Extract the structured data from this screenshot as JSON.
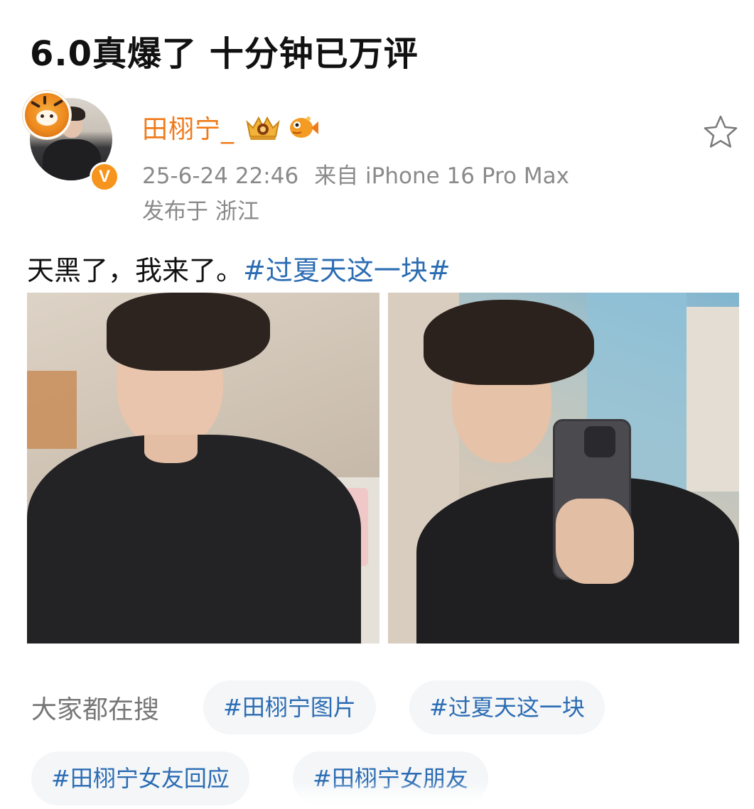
{
  "headline": "6.0真爆了 十分钟已万评",
  "post": {
    "author": {
      "name": "田栩宁_",
      "verified_badge": "V",
      "avatar": "avatar-image",
      "badges": [
        "crown-badge-icon",
        "fish-badge-icon"
      ]
    },
    "timestamp": "25-6-24 22:46",
    "source": "来自 iPhone 16 Pro Max",
    "location": "发布于 浙江",
    "text": "天黑了，我来了。",
    "topic": "#过夏天这一块#",
    "photos": [
      {
        "name": "post-photo-1"
      },
      {
        "name": "post-photo-2"
      }
    ]
  },
  "search": {
    "label": "大家都在搜",
    "chips": [
      "#田栩宁图片",
      "#过夏天这一块",
      "#田栩宁女友回应",
      "#田栩宁女朋友"
    ]
  },
  "colors": {
    "username": "#f07a1a",
    "topic_link": "#2b6cb3",
    "meta_text": "#8a8a8a",
    "chip_bg": "#f4f6f8",
    "verified": "#f7941d"
  }
}
